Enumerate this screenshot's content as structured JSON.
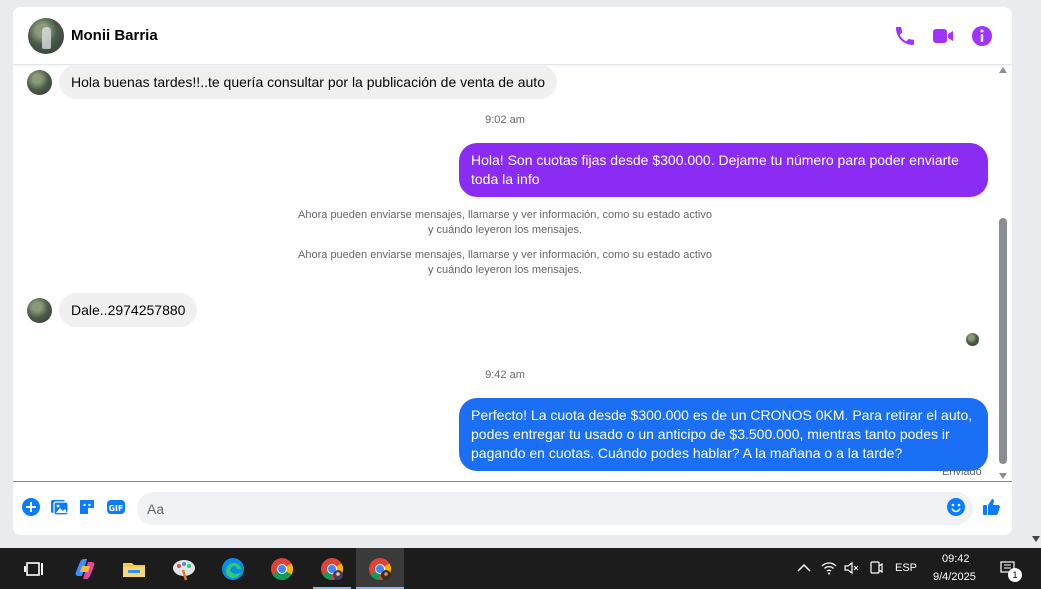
{
  "header": {
    "contact_name": "Monii Barria",
    "icons": [
      "phone-icon",
      "video-camera-icon",
      "info-icon"
    ],
    "accent_color": "#a033ff"
  },
  "conversation": {
    "messages": [
      {
        "type": "incoming",
        "text": "Hola buenas tardes!!..te quería consultar por la publicación de venta de auto"
      },
      {
        "type": "timestamp",
        "text": "9:02 am"
      },
      {
        "type": "outgoing",
        "text": "Hola! Son cuotas fijas desde $300.000. Dejame tu número para poder enviarte toda la info",
        "color": "#8b2cf5"
      },
      {
        "type": "system",
        "text_line1": "Ahora pueden enviarse mensajes, llamarse y ver información, como su estado activo",
        "text_line2": "y cuándo leyeron los mensajes."
      },
      {
        "type": "system",
        "text_line1": "Ahora pueden enviarse mensajes, llamarse y ver información, como su estado activo",
        "text_line2": "y cuándo leyeron los mensajes."
      },
      {
        "type": "incoming",
        "text": "Dale..2974257880"
      },
      {
        "type": "timestamp",
        "text": "9:42 am"
      },
      {
        "type": "outgoing",
        "text": "Perfecto! La cuota desde $300.000 es de un CRONOS 0KM. Para retirar el auto, podes entregar tu usado o un anticipo de $3.500.000, mientras tanto podes ir pagando en cuotas. Cuándo podes hablar? A la mañana o a la tarde?",
        "color": "#1a6ff5"
      }
    ],
    "status": "Enviado"
  },
  "composer": {
    "placeholder": "Aa",
    "icons": [
      "plus-circle-icon",
      "photo-icon",
      "sticker-icon",
      "gif-icon",
      "emoji-icon",
      "thumbs-up-icon"
    ],
    "accent_color": "#0a7cff"
  },
  "taskbar": {
    "apps": [
      "task-view-icon",
      "copilot-icon",
      "file-explorer-icon",
      "paint-icon",
      "edge-icon",
      "chrome-icon",
      "chrome-profile-icon",
      "chrome-profile-active-icon"
    ],
    "tray": {
      "language": "ESP",
      "time": "09:42",
      "date": "9/4/2025",
      "notification_count": "1"
    }
  }
}
